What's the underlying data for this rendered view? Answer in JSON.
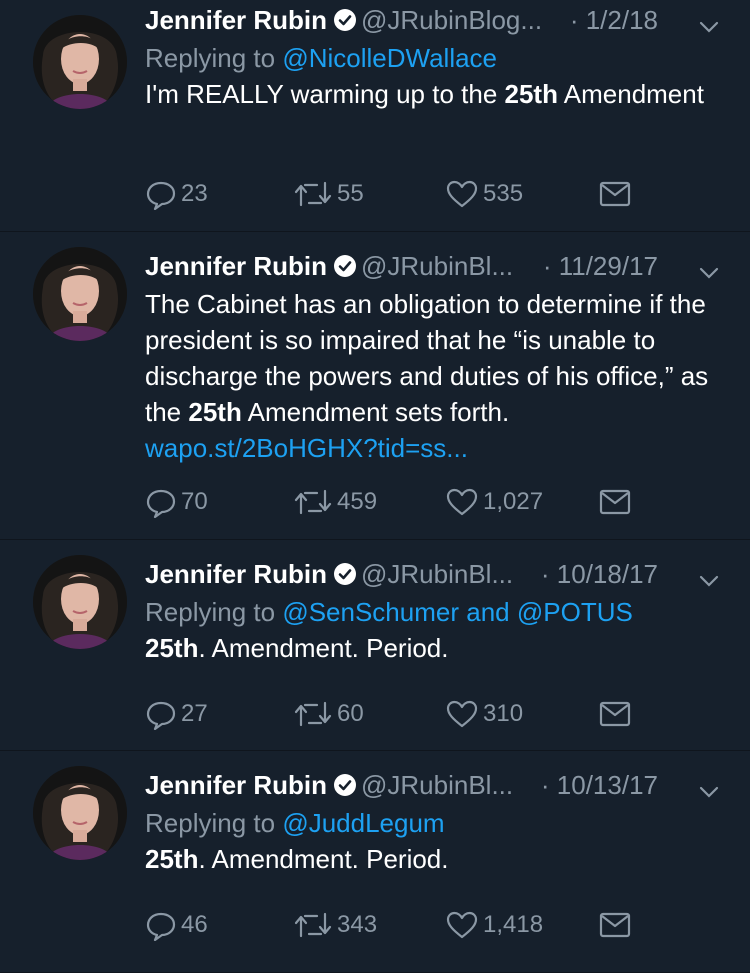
{
  "tweets": [
    {
      "author": "Jennifer Rubin",
      "handle": "@JRubinBlog...",
      "date": "· 1/2/18",
      "reply_prefix": "Replying to",
      "reply_to": "@NicolleDWallace",
      "reply_join": "",
      "reply_to2": "",
      "text_pre": "I'm REALLY warming up to the ",
      "text_bold": "25th",
      "text_post": " Amendment",
      "link": "",
      "replies": "23",
      "retweets": "55",
      "likes": "535"
    },
    {
      "author": "Jennifer Rubin",
      "handle": "@JRubinBl...",
      "date": "· 11/29/17",
      "reply_prefix": "",
      "reply_to": "",
      "reply_join": "",
      "reply_to2": "",
      "text_pre": "The Cabinet has an obligation to determine if the president is so impaired that he “is unable to discharge the powers and duties of his office,” as the ",
      "text_bold": "25th",
      "text_post": " Amendment sets forth. ",
      "link": "wapo.st/2BoHGHX?tid=ss...",
      "replies": "70",
      "retweets": "459",
      "likes": "1,027"
    },
    {
      "author": "Jennifer Rubin",
      "handle": "@JRubinBl...",
      "date": "· 10/18/17",
      "reply_prefix": "Replying to",
      "reply_to": "@SenSchumer",
      "reply_join": "and",
      "reply_to2": "@POTUS",
      "text_pre": "",
      "text_bold": "25th",
      "text_post": ". Amendment. Period.",
      "link": "",
      "replies": "27",
      "retweets": "60",
      "likes": "310"
    },
    {
      "author": "Jennifer Rubin",
      "handle": "@JRubinBl...",
      "date": "· 10/13/17",
      "reply_prefix": "Replying to",
      "reply_to": "@JuddLegum",
      "reply_join": "",
      "reply_to2": "",
      "text_pre": "",
      "text_bold": "25th",
      "text_post": ". Amendment. Period.",
      "link": "",
      "replies": "46",
      "retweets": "343",
      "likes": "1,418"
    }
  ],
  "icons": {
    "reply": "reply-icon",
    "retweet": "retweet-icon",
    "like": "heart-icon",
    "dm": "envelope-icon",
    "verified": "verified-badge-icon",
    "caret": "chevron-down-icon"
  },
  "colors": {
    "background": "#16202c",
    "secondary_text": "#8b98a5",
    "link": "#1da1f2",
    "divider": "#0f151d"
  }
}
